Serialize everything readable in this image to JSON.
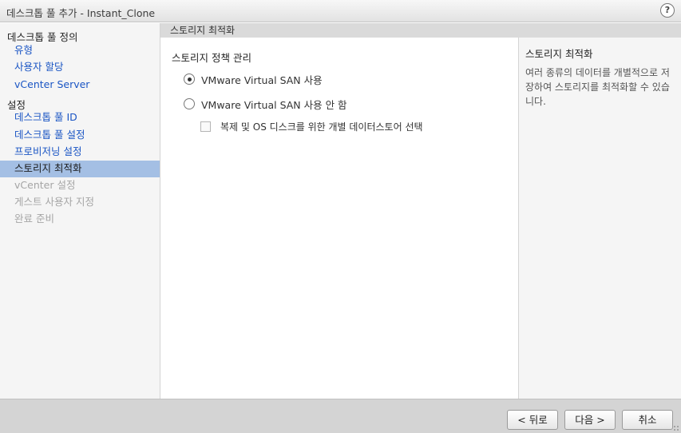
{
  "window": {
    "title": "데스크톱 풀 추가 - Instant_Clone",
    "help_label": "?"
  },
  "sidebar": {
    "sections": [
      {
        "label": "데스크톱 풀 정의"
      },
      {
        "label": "설정"
      }
    ],
    "items": [
      {
        "label": "유형",
        "state": "link"
      },
      {
        "label": "사용자 할당",
        "state": "link"
      },
      {
        "label": "vCenter Server",
        "state": "link"
      },
      {
        "label": "데스크톱 풀 ID",
        "state": "link"
      },
      {
        "label": "데스크톱 풀 설정",
        "state": "link"
      },
      {
        "label": "프로비저닝 설정",
        "state": "link"
      },
      {
        "label": "스토리지 최적화",
        "state": "selected"
      },
      {
        "label": "vCenter 설정",
        "state": "disabled"
      },
      {
        "label": "게스트 사용자 지정",
        "state": "disabled"
      },
      {
        "label": "완료 준비",
        "state": "disabled"
      }
    ]
  },
  "content": {
    "header": "스토리지 최적화",
    "section_title": "스토리지 정책 관리",
    "options": [
      {
        "label": "VMware Virtual SAN 사용",
        "checked": true
      },
      {
        "label": "VMware Virtual SAN 사용 안 함",
        "checked": false
      }
    ],
    "checkbox": {
      "label": "복제 및 OS 디스크를 위한 개별 데이터스토어 선택",
      "checked": false
    }
  },
  "help_panel": {
    "title": "스토리지 최적화",
    "text": "여러 종류의 데이터를 개별적으로 저장하여 스토리지를 최적화할 수 있습니다."
  },
  "footer": {
    "back_label": "< 뒤로",
    "next_label": "다음 >",
    "cancel_label": "취소"
  }
}
